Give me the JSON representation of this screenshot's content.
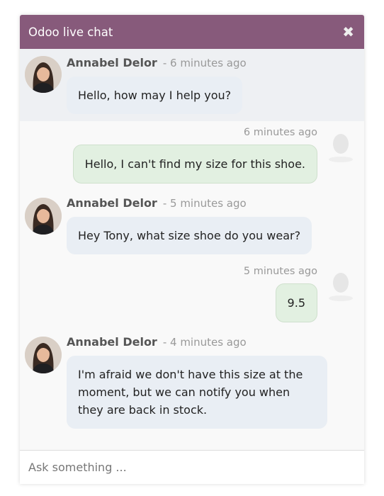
{
  "header": {
    "title": "Odoo live chat",
    "close_icon": "close-icon",
    "color": "#875a7b"
  },
  "messages": [
    {
      "author": "Annabel Delor",
      "time": "- 6 minutes ago",
      "text": "Hello, how may I help you?",
      "side": "left"
    },
    {
      "time": "6 minutes ago",
      "text": "Hello, I can't find my size for this shoe.",
      "side": "right"
    },
    {
      "author": "Annabel Delor",
      "time": "- 5 minutes ago",
      "text": "Hey Tony, what size shoe do you wear?",
      "side": "left"
    },
    {
      "time": "5 minutes ago",
      "text": "9.5",
      "side": "right"
    },
    {
      "author": "Annabel Delor",
      "time": "- 4 minutes ago",
      "text": "I'm afraid we don't have this size at the moment, but we can notify you when they are back in stock.",
      "side": "left"
    }
  ],
  "composer": {
    "placeholder": "Ask something ...",
    "value": ""
  }
}
